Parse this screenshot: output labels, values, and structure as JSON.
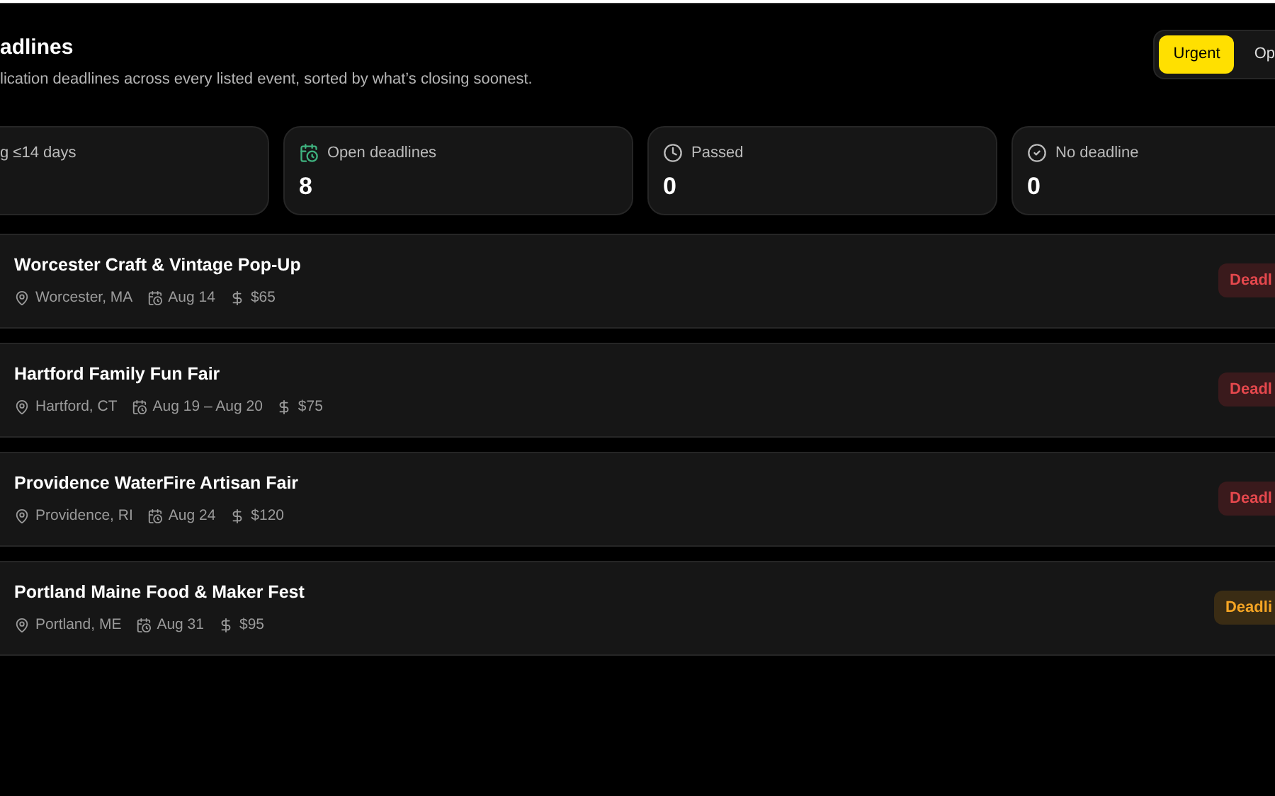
{
  "header": {
    "title": "adlines",
    "subtitle": "lication deadlines across every listed event, sorted by what’s closing soonest."
  },
  "filter_tabs": [
    {
      "label": "Urgent",
      "selected": true
    },
    {
      "label": "Op",
      "selected": false
    }
  ],
  "stats": [
    {
      "kind": "none",
      "label": "g ≤14 days"
    },
    {
      "kind": "open",
      "label": "Open deadlines",
      "value": "8"
    },
    {
      "kind": "passed",
      "label": "Passed",
      "value": "0"
    },
    {
      "kind": "nodeadline",
      "label": "No deadline",
      "value": "0"
    }
  ],
  "events": [
    {
      "name": "Worcester Craft & Vintage Pop-Up",
      "location": "Worcester, MA",
      "date": "Aug 14",
      "fee": "$65",
      "badge": "Deadl",
      "kind": "overdue"
    },
    {
      "name": "Hartford Family Fun Fair",
      "location": "Hartford, CT",
      "date": "Aug 19 – Aug 20",
      "fee": "$75",
      "badge": "Deadl",
      "kind": "overdue"
    },
    {
      "name": "Providence WaterFire Artisan Fair",
      "location": "Providence, RI",
      "date": "Aug 24",
      "fee": "$120",
      "badge": "Deadl",
      "kind": "overdue"
    },
    {
      "name": "Portland Maine Food & Maker Fest",
      "location": "Portland, ME",
      "date": "Aug 31",
      "fee": "$95",
      "badge": "Deadli",
      "kind": "soon"
    }
  ]
}
